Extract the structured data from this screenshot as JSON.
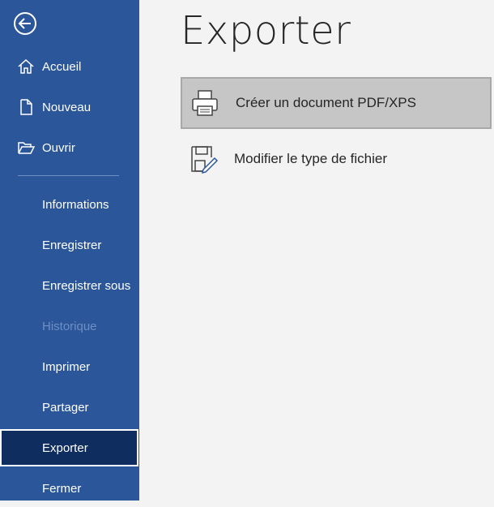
{
  "sidebar": {
    "back_icon": "back-arrow-circle-icon",
    "items": [
      {
        "label": "Accueil",
        "icon": "home-icon"
      },
      {
        "label": "Nouveau",
        "icon": "new-document-icon"
      },
      {
        "label": "Ouvrir",
        "icon": "open-folder-icon"
      },
      {
        "label": "Informations"
      },
      {
        "label": "Enregistrer"
      },
      {
        "label": "Enregistrer sous"
      },
      {
        "label": "Historique",
        "disabled": true
      },
      {
        "label": "Imprimer"
      },
      {
        "label": "Partager"
      },
      {
        "label": "Exporter",
        "active": true
      },
      {
        "label": "Fermer"
      }
    ]
  },
  "main": {
    "title": "Exporter",
    "options": [
      {
        "label": "Créer un document PDF/XPS",
        "icon": "pdf-printer-icon",
        "selected": true
      },
      {
        "label": "Modifier le type de fichier",
        "icon": "change-file-type-icon"
      }
    ]
  },
  "colors": {
    "sidebar_bg": "#2b579a",
    "active_bg": "#0f2d5f",
    "main_bg": "#f3f3f3",
    "selected_option_bg": "#c6c6c6"
  }
}
